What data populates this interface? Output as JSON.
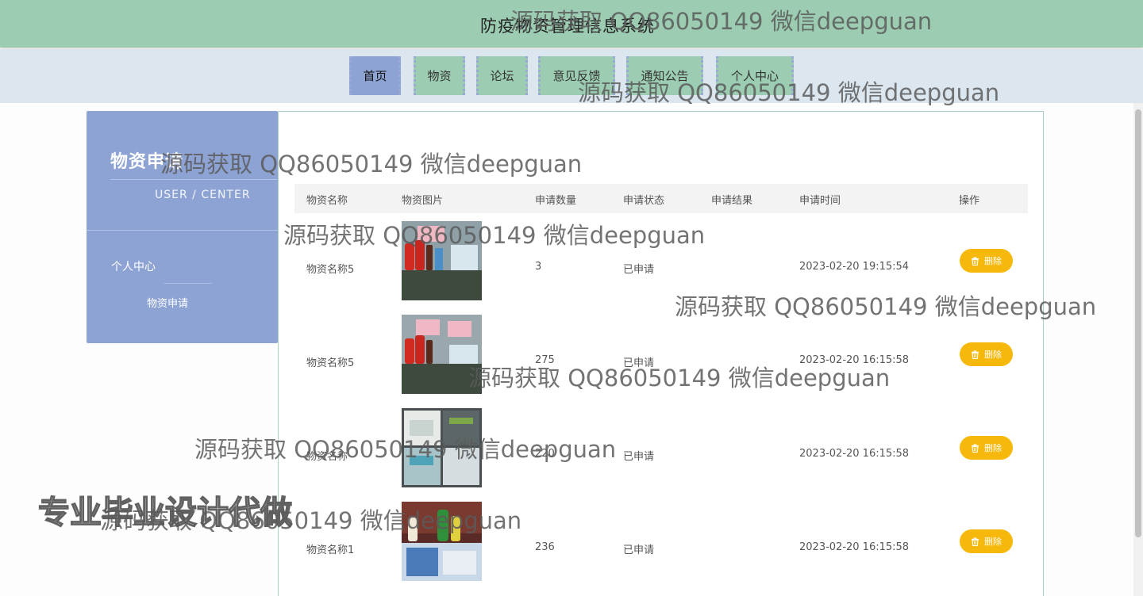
{
  "app": {
    "title": "防疫物资管理信息系统"
  },
  "nav": [
    {
      "label": "首页",
      "active": true
    },
    {
      "label": "物资",
      "active": false
    },
    {
      "label": "论坛",
      "active": false
    },
    {
      "label": "意见反馈",
      "active": false
    },
    {
      "label": "通知公告",
      "active": false
    },
    {
      "label": "个人中心",
      "active": false
    }
  ],
  "sidebar": {
    "title": "物资申请",
    "subtitle": "USER / CENTER",
    "menu_label": "个人中心",
    "sub_item": "物资申请"
  },
  "table": {
    "headers": [
      "物资名称",
      "物资图片",
      "申请数量",
      "申请状态",
      "申请结果",
      "申请时间",
      "操作"
    ],
    "rows": [
      {
        "name": "物资名称5",
        "quantity": "3",
        "status": "已申请",
        "result": "",
        "time": "2023-02-20 19:15:54",
        "action": "删除"
      },
      {
        "name": "物资名称5",
        "quantity": "275",
        "status": "已申请",
        "result": "",
        "time": "2023-02-20 16:15:58",
        "action": "删除"
      },
      {
        "name": "物资名称",
        "quantity": "220",
        "status": "已申请",
        "result": "",
        "time": "2023-02-20 16:15:58",
        "action": "删除"
      },
      {
        "name": "物资名称1",
        "quantity": "236",
        "status": "已申请",
        "result": "",
        "time": "2023-02-20 16:15:58",
        "action": "删除"
      }
    ]
  },
  "watermarks": {
    "text": "源码获取 QQ86050149 微信deepguan",
    "big": "专业毕业设计代做"
  },
  "colors": {
    "header_bg": "#9ccdb2",
    "nav_bg": "#dbe6ef",
    "nav_active": "#8da3d4",
    "sidebar_bg": "#8da3d4",
    "delete_button": "#f6b80a"
  }
}
